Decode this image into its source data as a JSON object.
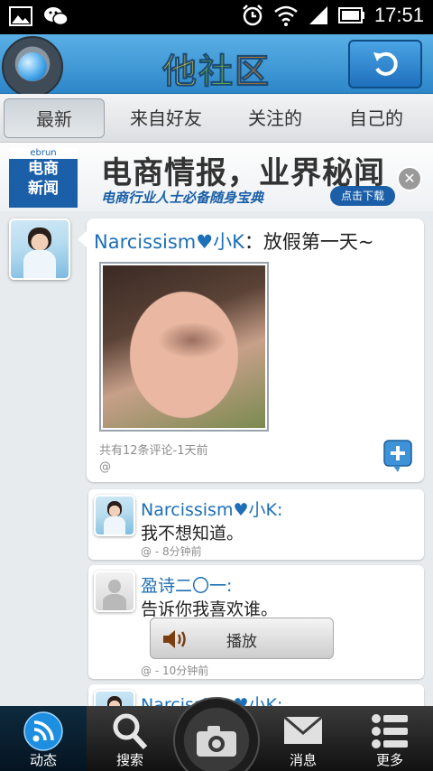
{
  "status_bar": {
    "time": "17:51",
    "icons": [
      "gallery-icon",
      "wechat-icon",
      "alarm-icon",
      "wifi-icon",
      "signal-icon",
      "battery-icon"
    ]
  },
  "header": {
    "title_chars": [
      "他",
      "社",
      "区"
    ],
    "refresh_icon": "refresh-icon"
  },
  "tabs": [
    {
      "label": "最新",
      "selected": true
    },
    {
      "label": "来自好友",
      "selected": false
    },
    {
      "label": "关注的",
      "selected": false
    },
    {
      "label": "自己的",
      "selected": false
    }
  ],
  "ad": {
    "logo_small": "ebrun",
    "logo_line1": "电商",
    "logo_line2": "新闻",
    "headline": "电商情报，业界秘闻",
    "subline": "电商行业人士必备随身宝典",
    "cta": "点击下载"
  },
  "post": {
    "username": "Narcissism♥小K",
    "separator": "：",
    "text": "放假第一天~",
    "meta": "共有12条评论-1天前",
    "meta_at": "@"
  },
  "comments": [
    {
      "username": "Narcissism♥小K:",
      "text": "我不想知道。",
      "meta": "@ - 8分钟前"
    },
    {
      "username": "盈诗二〇一:",
      "text": "告诉你我喜欢谁。",
      "voice_label": "播放",
      "meta": "@ - 10分钟前"
    },
    {
      "username": "Narcissism♥小K:"
    }
  ],
  "bottom_nav": [
    {
      "label": "动态",
      "icon": "feed-icon",
      "active": true
    },
    {
      "label": "搜索",
      "icon": "search-icon",
      "active": false
    },
    {
      "label": "",
      "icon": "camera-icon",
      "active": false
    },
    {
      "label": "消息",
      "icon": "mail-icon",
      "active": false
    },
    {
      "label": "更多",
      "icon": "more-list-icon",
      "active": false
    }
  ],
  "colors": {
    "accent_blue": "#2d86c8",
    "username_blue": "#1d6fb6"
  }
}
